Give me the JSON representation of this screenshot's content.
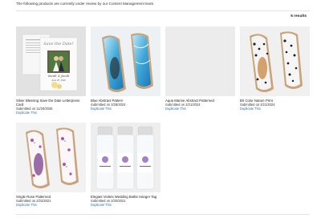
{
  "header": {
    "notice": "The following products are currently under review by our Content Management team.",
    "results": "6 results"
  },
  "products": [
    {
      "title": "Silver Blessing Save the Date Letterpress Card",
      "submitted": "Submitted on 11/20/2025",
      "action": "Duplicate This",
      "card_headline": "Save the Date!",
      "card_names": "Sarah & Jacob",
      "card_date": "June 25, 2026"
    },
    {
      "title": "Blue Abstract Pattern",
      "submitted": "Submitted on 2/28/2024",
      "action": "Duplicate This"
    },
    {
      "title": "Aqua Marine Abstract Patterned",
      "submitted": "Submitted on 2/21/2024",
      "action": "Duplicate This"
    },
    {
      "title": "B/I Color Nature Print",
      "submitted": "Submitted on 2/21/2024",
      "action": "Duplicate This"
    },
    {
      "title": "Single Rose Patterned",
      "submitted": "Submitted on 2/22/2021",
      "action": "Duplicate This"
    },
    {
      "title": "Elegant Violets Wedding Bottle Hanger Tag",
      "submitted": "Submitted on 2/20/2021",
      "action": "Duplicate This"
    }
  ]
}
